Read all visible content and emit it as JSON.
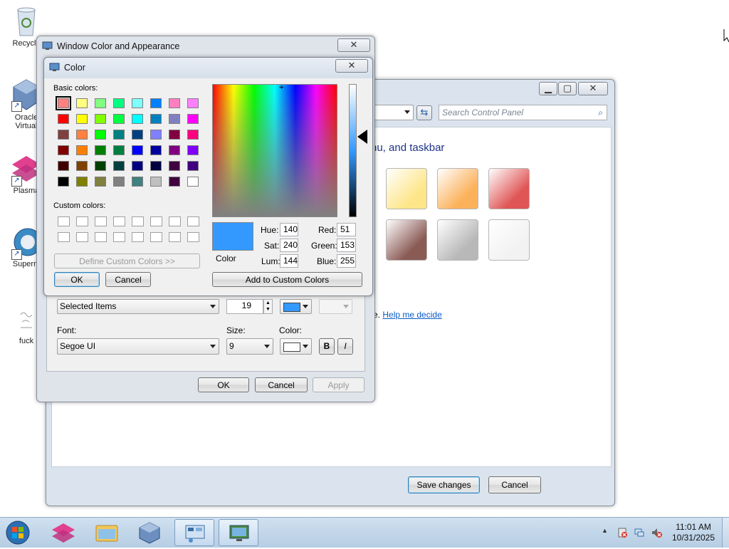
{
  "desktop": {
    "icons": [
      {
        "label": "Recycle"
      },
      {
        "label": "Oracle"
      },
      {
        "label": "Virtual"
      },
      {
        "label": "Plasma"
      },
      {
        "label": "Superm"
      },
      {
        "label": "fuck"
      }
    ]
  },
  "control_panel": {
    "search_placeholder": "Search Control Panel",
    "heading": "nu, and taskbar",
    "link_suffix": "ce.",
    "link": "Help me decide",
    "save_button": "Save changes",
    "cancel_button": "Cancel",
    "colors": [
      "#fde68a",
      "#fbb15a",
      "#e05555",
      "#8a5a55",
      "#b8b8b8",
      "#f2f2f2"
    ]
  },
  "appearance": {
    "title": "Window Color and Appearance",
    "item_value": "Selected Items",
    "item_size": "19",
    "font_label": "Font:",
    "font_value": "Segoe UI",
    "size_label": "Size:",
    "size_value": "9",
    "color_label": "Color:",
    "bold_label": "B",
    "italic_label": "I",
    "ok": "OK",
    "cancel": "Cancel",
    "apply": "Apply"
  },
  "color_dialog": {
    "title": "Color",
    "basic_colors_label": "Basic colors:",
    "custom_colors_label": "Custom colors:",
    "define_custom": "Define Custom Colors >>",
    "ok": "OK",
    "cancel": "Cancel",
    "add_custom": "Add to Custom Colors",
    "color_label": "Color",
    "preview_color": "#3399ff",
    "hue_label": "Hue:",
    "hue": "140",
    "sat_label": "Sat:",
    "sat": "240",
    "lum_label": "Lum:",
    "lum": "144",
    "red_label": "Red:",
    "red": "51",
    "green_label": "Green:",
    "green": "153",
    "blue_label": "Blue:",
    "blue": "255",
    "basic_colors": [
      "#ff8080",
      "#ffff80",
      "#80ff80",
      "#00ff80",
      "#80ffff",
      "#0080ff",
      "#ff80c0",
      "#ff80ff",
      "#ff0000",
      "#ffff00",
      "#80ff00",
      "#00ff40",
      "#00ffff",
      "#0080c0",
      "#8080c0",
      "#ff00ff",
      "#804040",
      "#ff8040",
      "#00ff00",
      "#008080",
      "#004080",
      "#8080ff",
      "#800040",
      "#ff0080",
      "#800000",
      "#ff8000",
      "#008000",
      "#008040",
      "#0000ff",
      "#0000a0",
      "#800080",
      "#8000ff",
      "#400000",
      "#804000",
      "#004000",
      "#004040",
      "#000080",
      "#000040",
      "#400040",
      "#400080",
      "#000000",
      "#808000",
      "#808040",
      "#808080",
      "#408080",
      "#c0c0c0",
      "#400040",
      "#ffffff"
    ]
  },
  "taskbar": {
    "time": "11:01 AM",
    "date": "10/31/2025"
  }
}
